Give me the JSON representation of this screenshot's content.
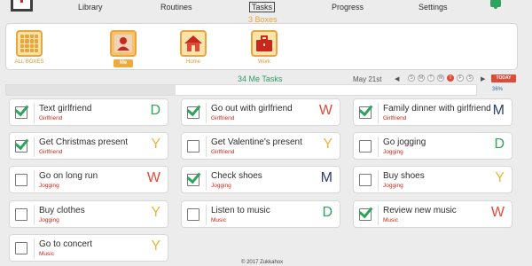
{
  "nav": {
    "items": [
      "Library",
      "Routines",
      "Tasks",
      "Progress",
      "Settings"
    ],
    "active": "Tasks"
  },
  "boxes_label": "3 Boxes",
  "categories": [
    {
      "label": "ALL BOXES",
      "icon": "grid-icon"
    },
    {
      "label": "Me",
      "icon": "person-icon",
      "selected": true
    },
    {
      "label": "Home",
      "icon": "house-icon"
    },
    {
      "label": "Work",
      "icon": "briefcase-icon"
    }
  ],
  "tasks_header": "34 Me Tasks",
  "date": "May 21st",
  "days": [
    "S",
    "M",
    "T",
    "W",
    "T",
    "F",
    "S"
  ],
  "today_index": 4,
  "today_label": "TODAY",
  "progress_pct": 36,
  "progress_label": "36%",
  "colors": {
    "D": "#2ea35c",
    "W": "#dd4b39",
    "Y": "#e8b73c",
    "M": "#2c3e6b",
    "accent": "#e8a63c",
    "check": "#2ea35c"
  },
  "tasks": [
    {
      "name": "Text girlfriend",
      "category": "Girlfriend",
      "letter": "D",
      "checked": true
    },
    {
      "name": "Go out with girlfriend",
      "category": "Girlfriend",
      "letter": "W",
      "checked": true
    },
    {
      "name": "Family dinner with girlfriend",
      "category": "Girlfriend",
      "letter": "M",
      "checked": true
    },
    {
      "name": "Get Christmas present",
      "category": "Girlfriend",
      "letter": "Y",
      "checked": true
    },
    {
      "name": "Get Valentine's present",
      "category": "Girlfriend",
      "letter": "Y",
      "checked": false
    },
    {
      "name": "Go jogging",
      "category": "Jogging",
      "letter": "D",
      "checked": false
    },
    {
      "name": "Go on long run",
      "category": "Jogging",
      "letter": "W",
      "checked": false
    },
    {
      "name": "Check shoes",
      "category": "Jogging",
      "letter": "M",
      "checked": true
    },
    {
      "name": "Buy shoes",
      "category": "Jogging",
      "letter": "Y",
      "checked": false
    },
    {
      "name": "Buy clothes",
      "category": "Jogging",
      "letter": "Y",
      "checked": false
    },
    {
      "name": "Listen to music",
      "category": "Music",
      "letter": "D",
      "checked": false
    },
    {
      "name": "Review new music",
      "category": "Music",
      "letter": "W",
      "checked": true
    },
    {
      "name": "Go to concert",
      "category": "Music",
      "letter": "Y",
      "checked": false
    }
  ],
  "footer": "© 2017 Zukkahox"
}
